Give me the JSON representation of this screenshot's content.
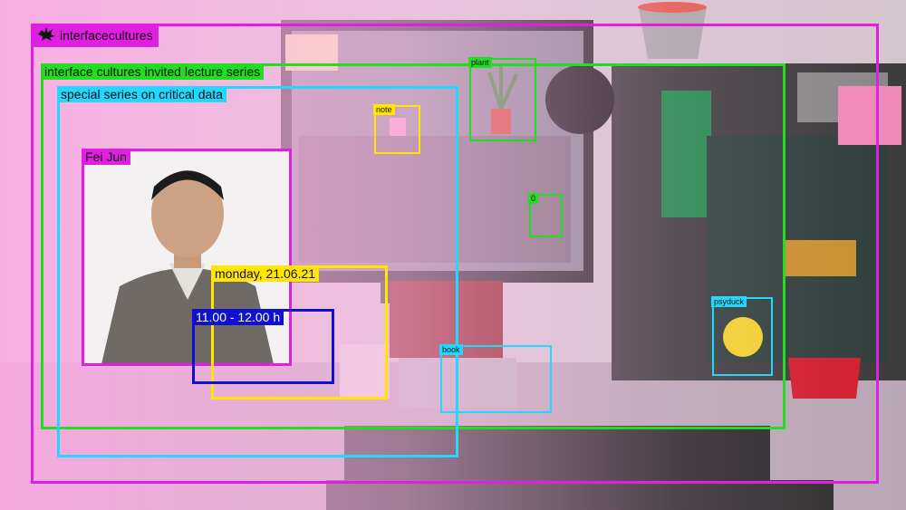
{
  "brand": {
    "name": "interfacecultures",
    "logo_icon": "splat-logo-icon"
  },
  "frames": {
    "series": "interface cultures invited lecture series",
    "subseries": "special series on critical data",
    "speaker": "Fei Jun",
    "date": "monday, 21.06.21",
    "time": "11.00 - 12.00 h"
  },
  "objects": {
    "plant": "plant",
    "note": "note",
    "zero": "0",
    "psyduck": "psyduck",
    "book": "book"
  },
  "colors": {
    "magenta": "#e020e0",
    "green": "#22dd22",
    "cyan": "#22d8ff",
    "yellow": "#ffe600",
    "blue": "#1010d0"
  }
}
